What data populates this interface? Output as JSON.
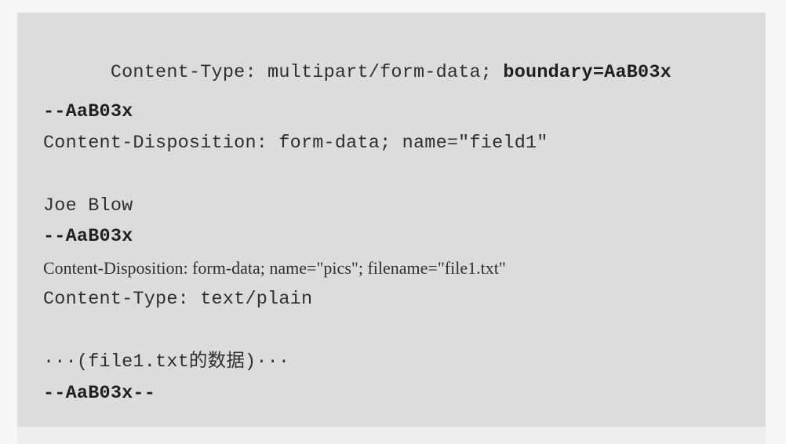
{
  "lines": {
    "l1_prefix": "Content-Type: multipart/form-data; ",
    "l1_bold": "boundary=AaB03x",
    "l2": "--AaB03x",
    "l3": "Content-Disposition: form-data; name=\"field1\"",
    "l4": "Joe Blow",
    "l5": "--AaB03x",
    "l6": "Content-Disposition: form-data; name=\"pics\"; filename=\"file1.txt\"",
    "l7": "Content-Type: text/plain",
    "l8": "···(file1.txt的数据)···",
    "l9": "--AaB03x--"
  }
}
